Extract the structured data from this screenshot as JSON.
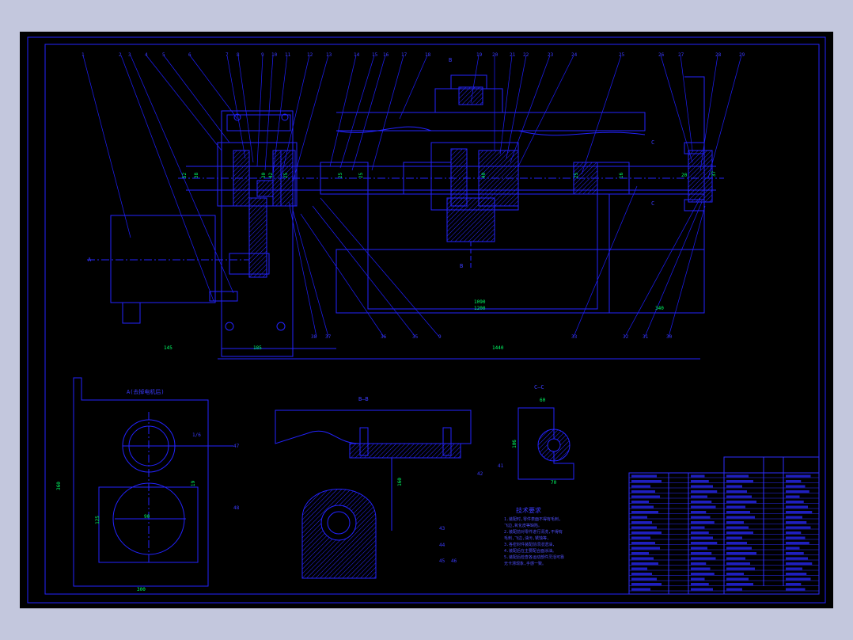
{
  "colors": {
    "background": "#000000",
    "frame": "#2c2cff",
    "line": "#1a1aff",
    "dimension": "#00ff66",
    "hatch": "#3030ff",
    "window": "#c3c7dd"
  },
  "section_labels": {
    "view_a": "A(去掉电机后)",
    "section_bb": "B—B",
    "section_cc": "C—C",
    "mark_a": "A",
    "mark_b_top": "B",
    "mark_b_bot": "B",
    "mark_c_top": "C",
    "mark_c_bot": "C"
  },
  "dimensions": {
    "d52": "52",
    "d38": "38",
    "d30": "30",
    "d42": "42",
    "d25a": "25",
    "d25b": "25",
    "d25c": "25",
    "d40": "40",
    "d25d": "25",
    "d16": "16",
    "d20": "20",
    "d37": "37",
    "l145": "145",
    "l185": "185",
    "l1440": "1440",
    "l1090": "1090",
    "l1200": "1200",
    "l340": "340",
    "av_height": "360",
    "av_width": "300",
    "av_19": "19",
    "av_left": "125",
    "av_90": "90",
    "bb_160": "160",
    "cc_60": "60",
    "cc_106": "106",
    "cc_70": "70"
  },
  "balloons_top": [
    "1",
    "2",
    "3",
    "4",
    "5",
    "6",
    "7",
    "8",
    "9",
    "10",
    "11",
    "12",
    "13",
    "14",
    "15",
    "16",
    "17",
    "18",
    "19",
    "20",
    "21",
    "22",
    "23",
    "24",
    "25",
    "26",
    "27",
    "28",
    "29"
  ],
  "balloons_bottom": [
    "38",
    "37",
    "36",
    "35",
    "9",
    "33",
    "32",
    "31",
    "30"
  ],
  "balloons_sections": [
    "1/6",
    "47",
    "48",
    "42",
    "43",
    "44",
    "45",
    "46",
    "41"
  ],
  "technical_notes": {
    "title": "技术要求",
    "lines": [
      "1.装配时,零件表面不得有毛刺,",
      "飞边,氧化皮等缺陷。",
      "2.装配前对零件进行清洗,不得有",
      "毛刺,飞边,油污,锈蚀等,",
      "3.各密封件装配前须浸透油,",
      "4.装配后在主要配合面涂油。",
      "5.装配后检查各运动部件灵活可靠",
      "无卡滞现象,手感一致。"
    ]
  }
}
